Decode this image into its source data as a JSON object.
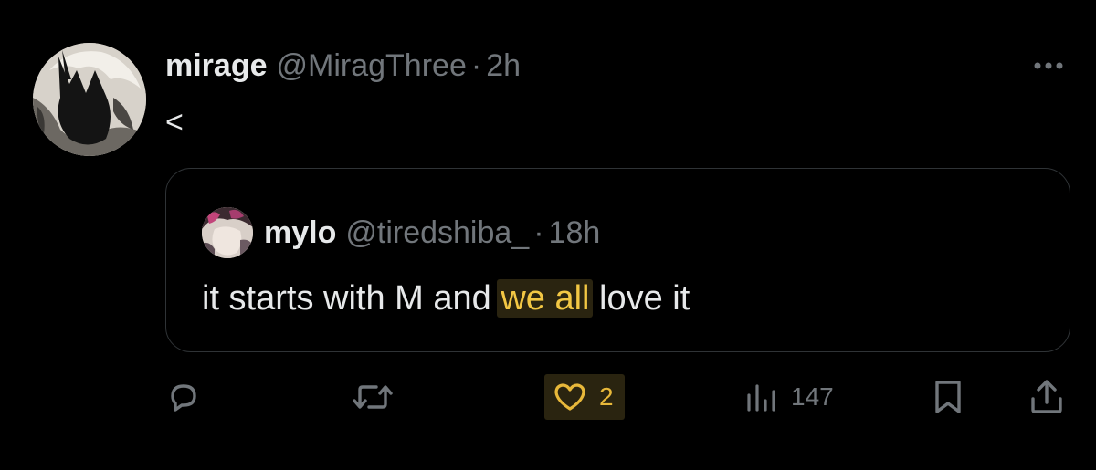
{
  "post": {
    "author_name": "mirage",
    "author_handle": "@MiragThree",
    "separator": "·",
    "time": "2h",
    "text": "<"
  },
  "quote": {
    "author_name": "mylo",
    "author_handle": "@tiredshiba_",
    "separator": "·",
    "time": "18h",
    "text_before": "it starts with M and ",
    "text_highlight": "we all",
    "text_after": " love it"
  },
  "actions": {
    "reply_count": "",
    "repost_count": "",
    "like_count": "2",
    "views_count": "147"
  },
  "icons": {
    "more": "more-horizontal-icon",
    "reply": "reply-icon",
    "repost": "repost-icon",
    "like": "heart-icon",
    "views": "views-chart-icon",
    "bookmark": "bookmark-icon",
    "share": "share-icon"
  },
  "colors": {
    "background": "#000000",
    "primary_text": "#e7e9ea",
    "secondary_text": "#71767b",
    "border": "#2f3336",
    "highlight_text": "#f2c744",
    "highlight_bg": "#2a2410"
  }
}
